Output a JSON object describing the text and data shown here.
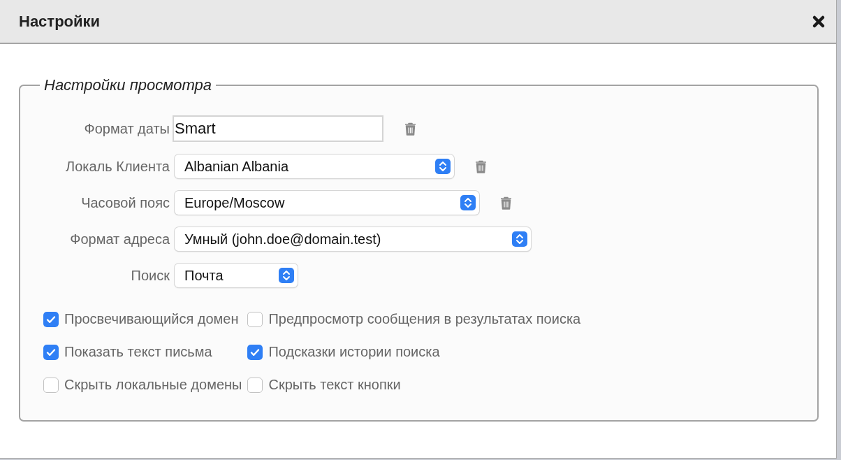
{
  "dialog": {
    "title": "Настройки"
  },
  "fieldset": {
    "legend": "Настройки просмотра",
    "fields": [
      {
        "label": "Формат даты",
        "kind": "text",
        "value": "Smart",
        "clearable": true
      },
      {
        "label": "Локаль Клиента",
        "kind": "select",
        "value": "Albanian Albania",
        "clearable": true
      },
      {
        "label": "Часовой пояс",
        "kind": "select",
        "value": "Europe/Moscow",
        "clearable": true
      },
      {
        "label": "Формат адреса",
        "kind": "select",
        "value": "Умный (john.doe@domain.test)",
        "clearable": false
      },
      {
        "label": "Поиск",
        "kind": "select",
        "value": "Почта",
        "clearable": false
      }
    ],
    "checkboxes": [
      {
        "label": "Просвечивающийся домен",
        "checked": true
      },
      {
        "label": "Предпросмотр сообщения в результатах поиска",
        "checked": false
      },
      {
        "label": "Показать текст письма",
        "checked": true
      },
      {
        "label": "Подсказки истории поиска",
        "checked": true
      },
      {
        "label": "Скрыть локальные домены",
        "checked": false
      },
      {
        "label": "Скрыть текст кнопки",
        "checked": false
      }
    ]
  }
}
